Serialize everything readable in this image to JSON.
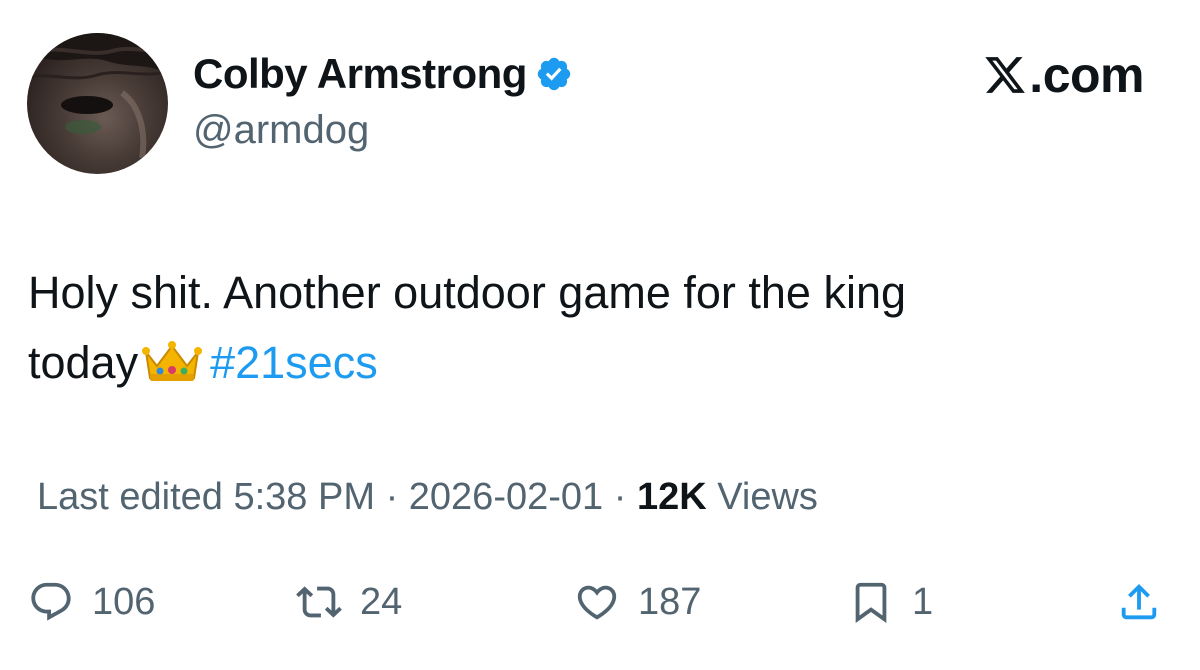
{
  "author": {
    "display_name": "Colby Armstrong",
    "handle": "@armdog",
    "verified": true
  },
  "brand": {
    "label": ".com",
    "logo": "x-logo-icon"
  },
  "tweet": {
    "text_line_1": "Holy shit. Another outdoor game for the king",
    "text_line_2": "today",
    "emoji": "crown-icon",
    "hashtag": "#21secs"
  },
  "meta": {
    "edited_label": "Last edited 5:38 PM",
    "separator": "·",
    "date": "2026-02-01",
    "views_count": "12K",
    "views_label": "Views"
  },
  "actions": {
    "replies": "106",
    "reposts": "24",
    "likes": "187",
    "bookmarks": "1"
  },
  "colors": {
    "text": "#0f1419",
    "secondary": "#536471",
    "accent": "#1d9bf0"
  }
}
